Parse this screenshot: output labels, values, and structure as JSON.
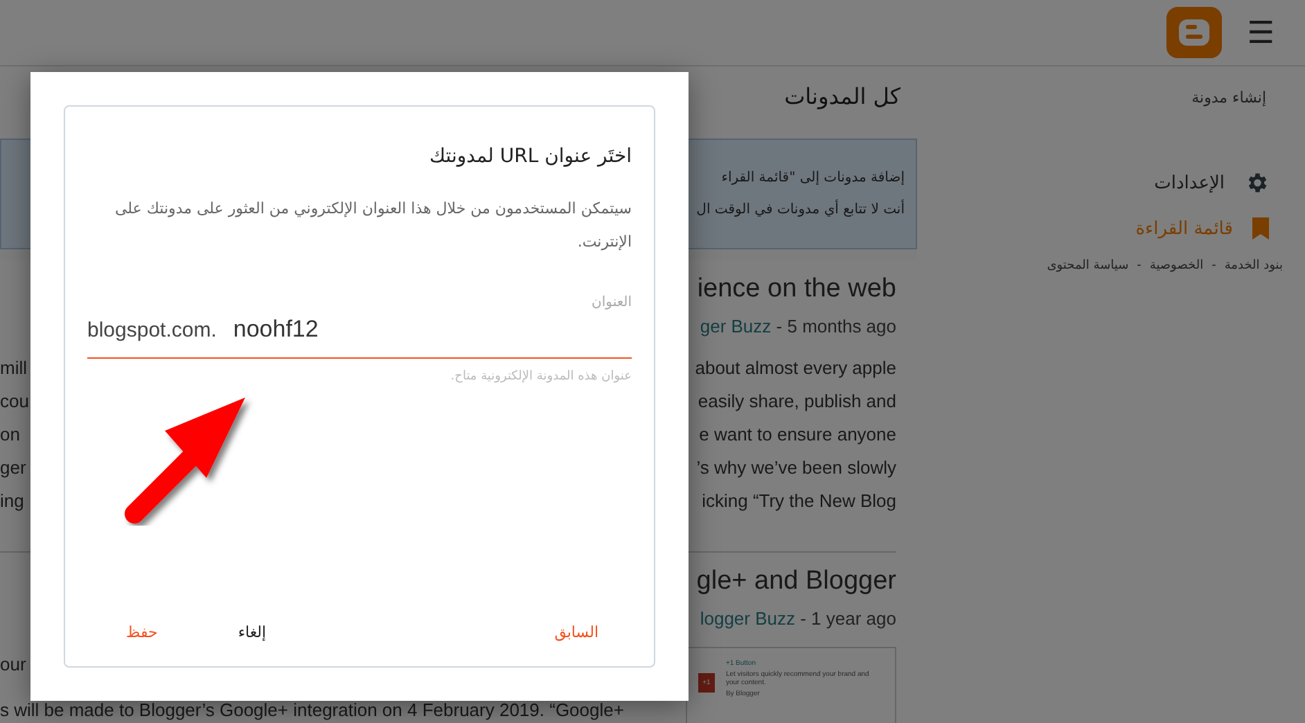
{
  "topbar": {
    "menu_icon": "☰"
  },
  "main": {
    "title": "كل المدونات",
    "notice": [
      "إضافة مدونات إلى \"قائمة القراء",
      "أنت لا تتابع أي مدونات في الوقت ال"
    ],
    "posts": [
      {
        "title": "ience on the web",
        "author": "ger Buzz",
        "age": " - 5 months ago",
        "lines": [
          {
            "left": "mill",
            "right": "about almost every apple"
          },
          {
            "left": "cou",
            "right": "easily share, publish and"
          },
          {
            "left": "on",
            "right": "e want to ensure anyone"
          },
          {
            "left": "ger",
            "right": "’s why we’ve been slowly"
          },
          {
            "left": "ing",
            "right": "icking “Try the New Blog"
          }
        ]
      },
      {
        "title": "gle+ and Blogger",
        "author": "logger Buzz",
        "age": " - 1 year ago",
        "lines": [
          {
            "left": "our"
          },
          {
            "left": "s will be made to Blogger’s Google+ integration on 4 February 2019. “Google+"
          }
        ],
        "widget": {
          "badge": "+1",
          "name": "+1 Button",
          "text": "Let visitors quickly recommend your brand and your content.",
          "by": "By Blogger"
        }
      }
    ]
  },
  "sidebar": {
    "create": "إنشاء مدونة",
    "items": [
      {
        "label": "الإعدادات",
        "kind": "gear",
        "selected": false
      },
      {
        "label": "قائمة القراءة",
        "kind": "bookmark",
        "selected": true
      }
    ],
    "footer": [
      "بنود الخدمة",
      "الخصوصية",
      "سياسة المحتوى"
    ],
    "separator": "-"
  },
  "dialog": {
    "title": "اختَر عنوان URL لمدونتك",
    "description": "سيتمكن المستخدمون من خلال هذا العنوان الإلكتروني من العثور على مدونتك على الإنترنت.",
    "field_label": "العنوان",
    "suffix": "blogspot.com.",
    "value": "noohf12",
    "helper": "عنوان هذه المدونة الإلكترونية متاح.",
    "buttons": [
      {
        "label": "السابق",
        "kind": "accent"
      },
      {
        "label": "إلغاء",
        "kind": "plain"
      },
      {
        "label": "حفظ",
        "kind": "accent"
      }
    ]
  }
}
